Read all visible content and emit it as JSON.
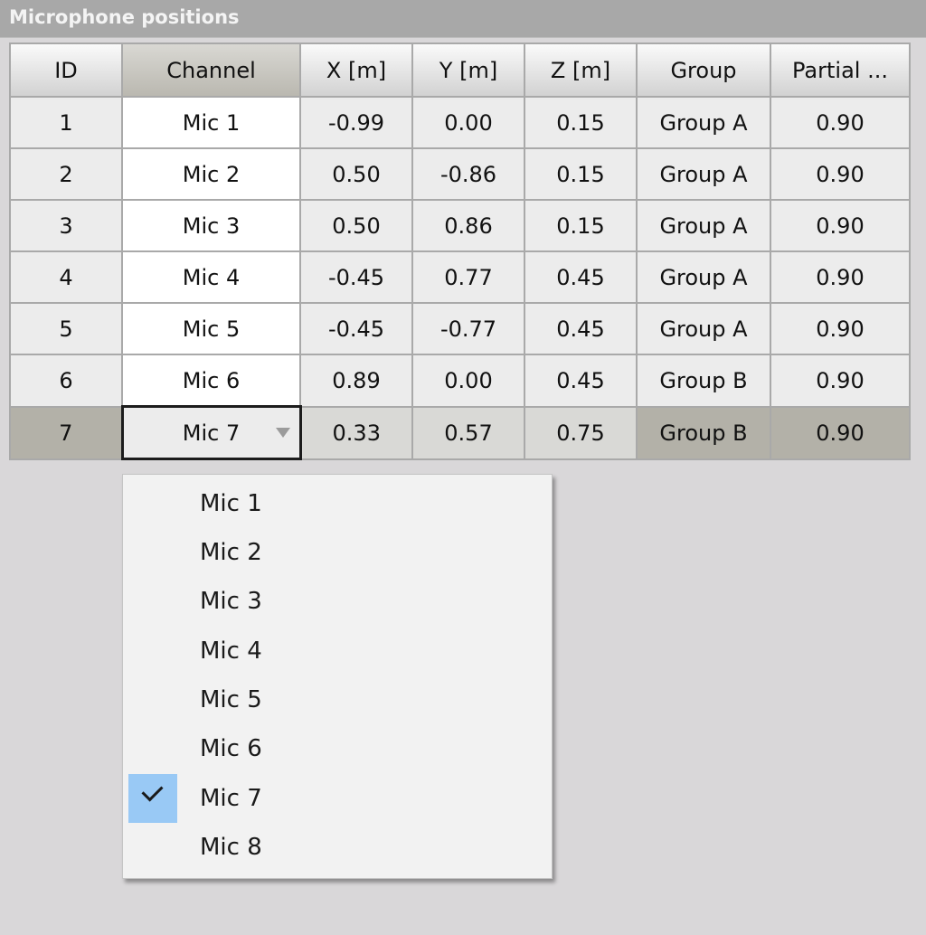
{
  "panel": {
    "title": "Microphone positions"
  },
  "table": {
    "columns": [
      "ID",
      "Channel",
      "X [m]",
      "Y [m]",
      "Z [m]",
      "Group",
      "Partial ..."
    ],
    "rows": [
      [
        "1",
        "Mic 1",
        "-0.99",
        "0.00",
        "0.15",
        "Group A",
        "0.90"
      ],
      [
        "2",
        "Mic 2",
        "0.50",
        "-0.86",
        "0.15",
        "Group A",
        "0.90"
      ],
      [
        "3",
        "Mic 3",
        "0.50",
        "0.86",
        "0.15",
        "Group A",
        "0.90"
      ],
      [
        "4",
        "Mic 4",
        "-0.45",
        "0.77",
        "0.45",
        "Group A",
        "0.90"
      ],
      [
        "5",
        "Mic 5",
        "-0.45",
        "-0.77",
        "0.45",
        "Group A",
        "0.90"
      ],
      [
        "6",
        "Mic 6",
        "0.89",
        "0.00",
        "0.45",
        "Group B",
        "0.90"
      ],
      [
        "7",
        "Mic 7",
        "0.33",
        "0.57",
        "0.75",
        "Group B",
        "0.90"
      ]
    ],
    "selected_row": 7
  },
  "dropdown": {
    "icon": "chevron-down-icon",
    "checkmark_icon": "checkmark-icon",
    "options": [
      "Mic 1",
      "Mic 2",
      "Mic 3",
      "Mic 4",
      "Mic 5",
      "Mic 6",
      "Mic 7",
      "Mic 8"
    ],
    "selected": "Mic 7",
    "highlight_color": "#99c9f5"
  }
}
